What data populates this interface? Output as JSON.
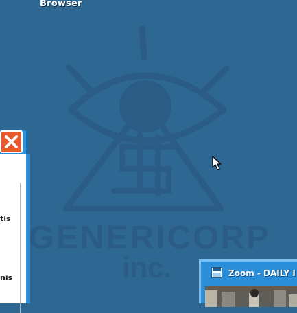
{
  "desktop": {
    "background_color": "#2f6793",
    "logo": {
      "line1": "GENERICORP",
      "line2": "inc.",
      "emblem_glyph": "$"
    },
    "icons": [
      {
        "label": "Browser",
        "icon": "browser-icon"
      }
    ]
  },
  "left_window": {
    "close_icon": "close-icon",
    "visible_text_fragments": [
      "tis",
      "nis"
    ]
  },
  "zoom_window": {
    "title": "Zoom - DAILY I",
    "icon": "zoom-app-icon"
  },
  "cursor": {
    "icon": "mouse-pointer-icon"
  }
}
